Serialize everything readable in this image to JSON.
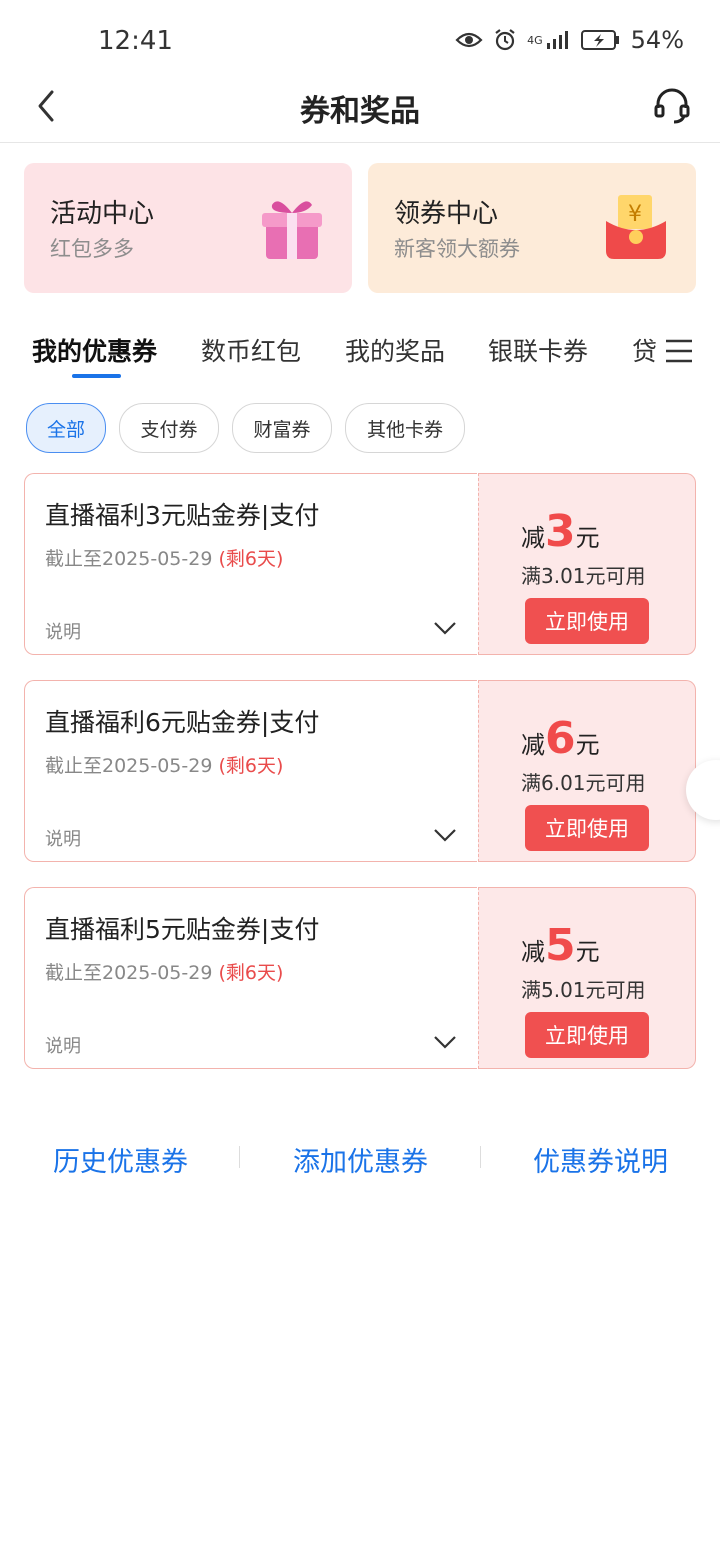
{
  "status": {
    "time": "12:41",
    "network": "4G",
    "battery": "54%"
  },
  "nav": {
    "title": "券和奖品"
  },
  "cards": [
    {
      "title": "活动中心",
      "subtitle": "红包多多",
      "icon": "gift-box-icon"
    },
    {
      "title": "领券中心",
      "subtitle": "新客领大额券",
      "icon": "red-envelope-icon"
    }
  ],
  "tabs": [
    "我的优惠券",
    "数币红包",
    "我的奖品",
    "银联卡券",
    "贷"
  ],
  "chips": [
    "全部",
    "支付券",
    "财富券",
    "其他卡券"
  ],
  "coupons": [
    {
      "title": "直播福利3元贴金券|支付",
      "date": "截止至2025-05-29",
      "remain": "(剩6天)",
      "note": "说明",
      "prefix": "减",
      "amount": "3",
      "unit": "元",
      "condition": "满3.01元可用",
      "button": "立即使用"
    },
    {
      "title": "直播福利6元贴金券|支付",
      "date": "截止至2025-05-29",
      "remain": "(剩6天)",
      "note": "说明",
      "prefix": "减",
      "amount": "6",
      "unit": "元",
      "condition": "满6.01元可用",
      "button": "立即使用"
    },
    {
      "title": "直播福利5元贴金券|支付",
      "date": "截止至2025-05-29",
      "remain": "(剩6天)",
      "note": "说明",
      "prefix": "减",
      "amount": "5",
      "unit": "元",
      "condition": "满5.01元可用",
      "button": "立即使用"
    }
  ],
  "footer": {
    "history": "历史优惠券",
    "add": "添加优惠券",
    "explain": "优惠券说明"
  },
  "colors": {
    "accent": "#1a73e8",
    "red": "#f04b4b",
    "card_pink": "#fde3e6",
    "card_peach": "#fdebd9"
  }
}
